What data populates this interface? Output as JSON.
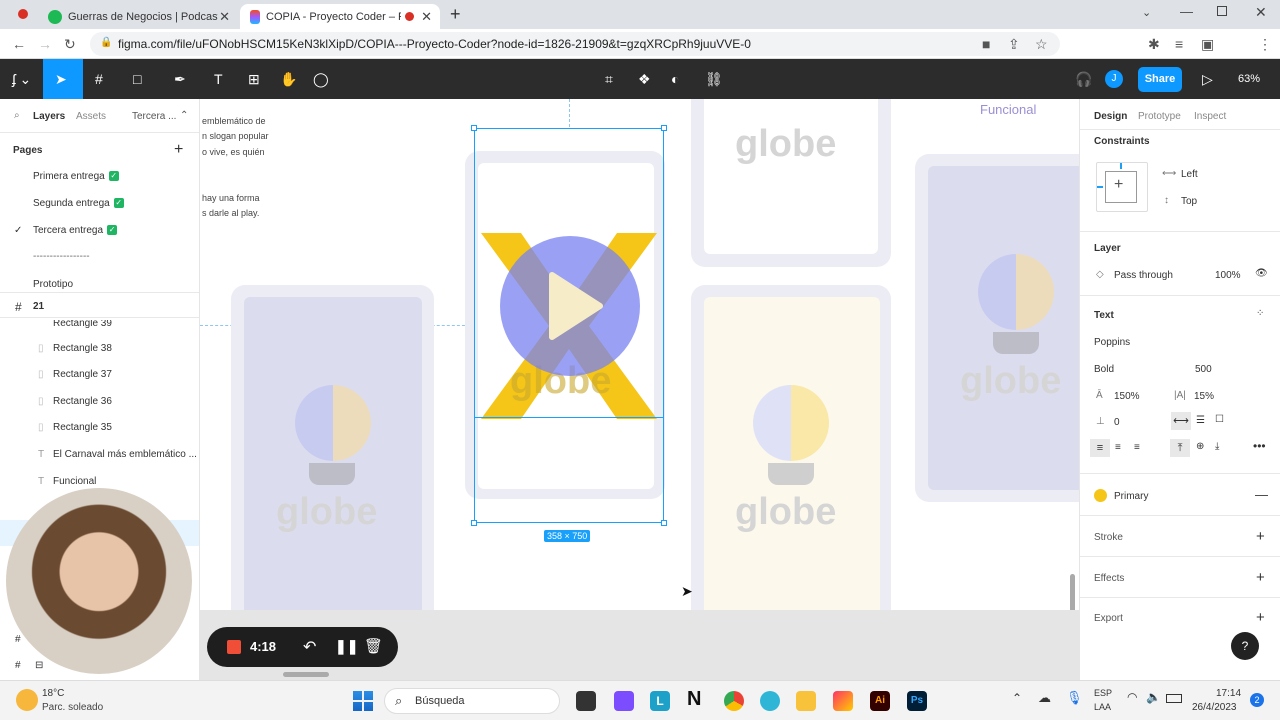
{
  "browser": {
    "tabs": [
      {
        "title": "Guerras de Negocios | Podcast c"
      },
      {
        "title": "COPIA - Proyecto Coder – Fi"
      }
    ],
    "url": "figma.com/file/uFONobHSCM15KeN3klXipD/COPIA---Proyecto-Coder?node-id=1826-21909&t=gzqXRCpRh9juuVVE-0"
  },
  "figma": {
    "share_label": "Share",
    "zoom": "63%",
    "user_initial": "J"
  },
  "left_panel": {
    "tabs": [
      "Layers",
      "Assets",
      "Tercera ..."
    ],
    "pages_title": "Pages",
    "pages": [
      "Primera entrega",
      "Segunda entrega",
      "Tercera entrega",
      "-----------------",
      "Prototipo"
    ],
    "frame": "21",
    "layers": [
      "Rectangle 39",
      "Rectangle 38",
      "Rectangle 37",
      "Rectangle 36",
      "Rectangle 35",
      "El Carnaval más emblemático ...",
      "Funcional"
    ]
  },
  "canvas": {
    "text_lines": [
      "emblemático de",
      "n slogan popular",
      "o vive, es quién",
      "hay una forma",
      "s darle al play."
    ],
    "globe_word": "globe",
    "funcional_label": "Funcional",
    "selection_size": "358 × 750"
  },
  "recorder": {
    "time": "4:18"
  },
  "right_panel": {
    "tabs": [
      "Design",
      "Prototype",
      "Inspect"
    ],
    "constraints_title": "Constraints",
    "constraint_h": "Left",
    "constraint_v": "Top",
    "layer_title": "Layer",
    "blend_mode": "Pass through",
    "opacity": "100%",
    "text_title": "Text",
    "font_family": "Poppins",
    "font_style": "Bold",
    "font_weight": "500",
    "line_height": "150%",
    "letter_spacing": "15%",
    "paragraph_spacing": "0",
    "fill_name": "Primary",
    "fill_color": "#f5c518",
    "stroke_title": "Stroke",
    "effects_title": "Effects",
    "export_title": "Export",
    "help": "?"
  },
  "taskbar": {
    "weather_temp": "18°C",
    "weather_desc": "Parc. soleado",
    "search_label": "Búsqueda",
    "lang": "ESP",
    "region": "LAA",
    "time": "17:14",
    "date": "26/4/2023",
    "notif_count": "2"
  }
}
